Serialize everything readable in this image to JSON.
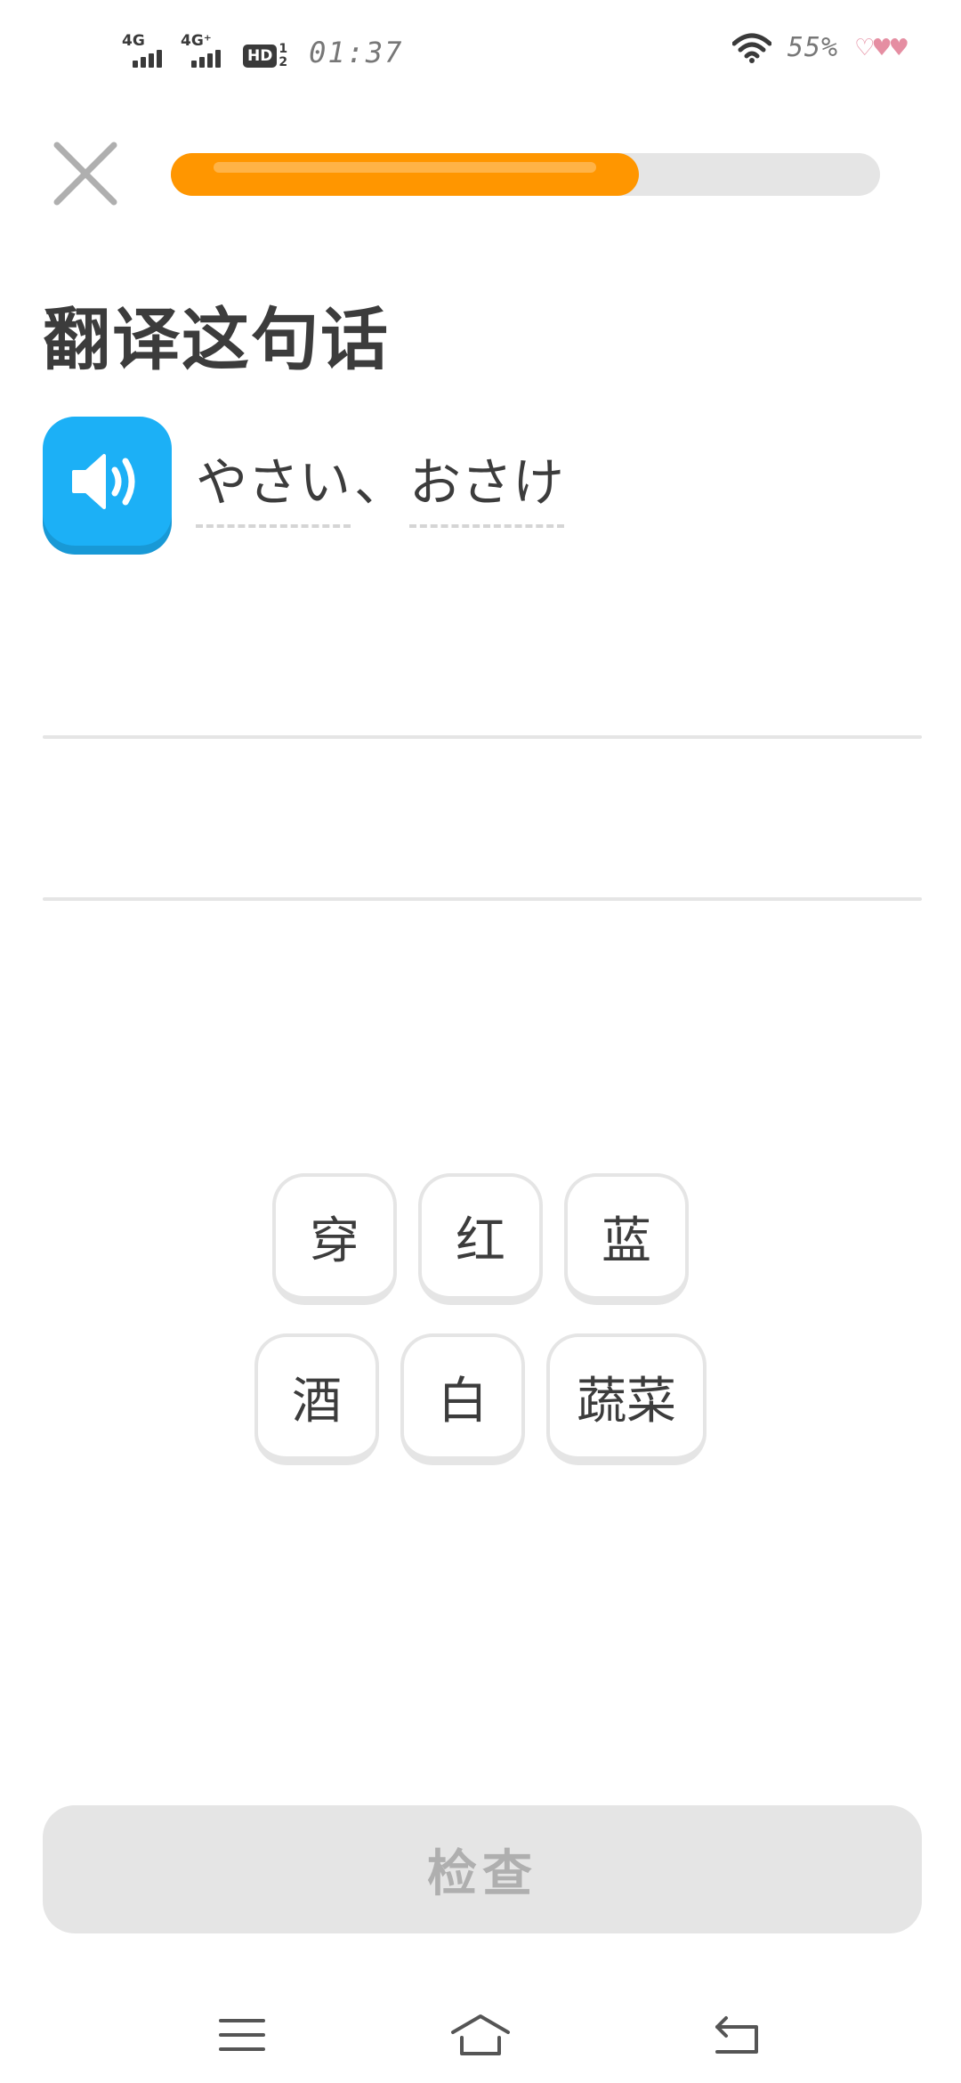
{
  "status_bar": {
    "signal1_label": "4G",
    "signal2_label": "4G⁺",
    "hd_label": "HD",
    "hd_top": "1",
    "hd_bottom": "2",
    "time": "01:37",
    "battery": "55%",
    "hearts": "♡♥♥"
  },
  "progress": {
    "value": 0.66,
    "color": "#ff9600"
  },
  "title": "翻译这句话",
  "prompt": {
    "tokens": [
      "やさい",
      "、",
      "おさけ"
    ]
  },
  "word_bank": {
    "row1": [
      "穿",
      "红",
      "蓝"
    ],
    "row2": [
      "酒",
      "白",
      "蔬菜"
    ]
  },
  "check_button": {
    "label": "检查"
  },
  "nav": {
    "menu_icon": "menu-icon",
    "home_icon": "home-icon",
    "back_icon": "back-icon"
  },
  "colors": {
    "accent_blue": "#1cb0f6",
    "progress_orange": "#ff9600",
    "disabled_gray": "#e5e5e5"
  }
}
